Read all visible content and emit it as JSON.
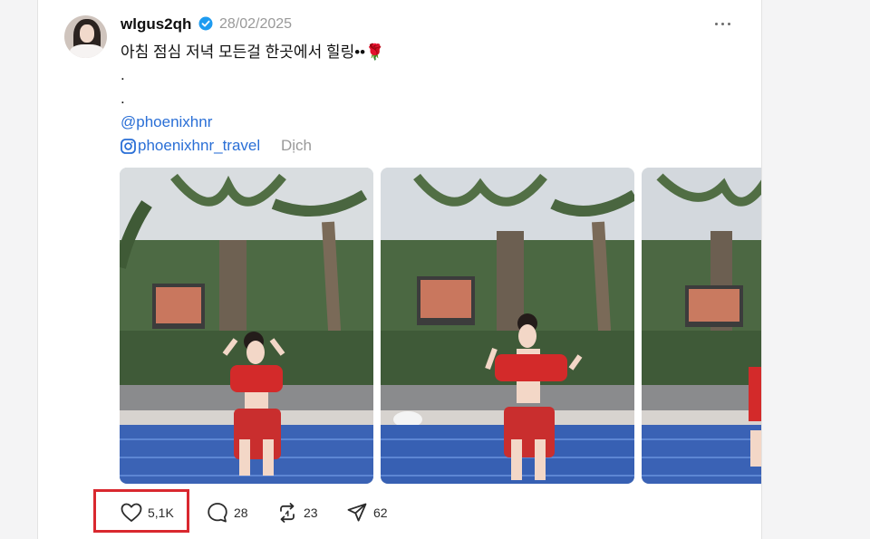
{
  "post": {
    "username": "wlgus2qh",
    "date": "28/02/2025",
    "text": "아침 점심 저녁 모든걸 한곳에서 힐링••🌹",
    "dot1": ".",
    "dot2": ".",
    "mention": "@phoenixhnr",
    "instagram_handle": "phoenixhnr_travel",
    "translate_label": "Dịch"
  },
  "photos": [
    {
      "alt": "photo-1"
    },
    {
      "alt": "photo-2"
    },
    {
      "alt": "photo-3"
    }
  ],
  "actions": {
    "likes": "5,1K",
    "comments": "28",
    "reposts": "23",
    "shares": "62"
  },
  "icons": {
    "verified": "verified-badge-icon",
    "more": "more-dots-icon",
    "instagram": "instagram-icon",
    "like": "heart-icon",
    "comment": "comment-bubble-icon",
    "repost": "repost-icon",
    "share": "send-icon"
  },
  "colors": {
    "link": "#2a6fd6",
    "verified": "#1d9bf0",
    "highlight": "#d9282f",
    "swimsuit": "#d32a2a"
  }
}
